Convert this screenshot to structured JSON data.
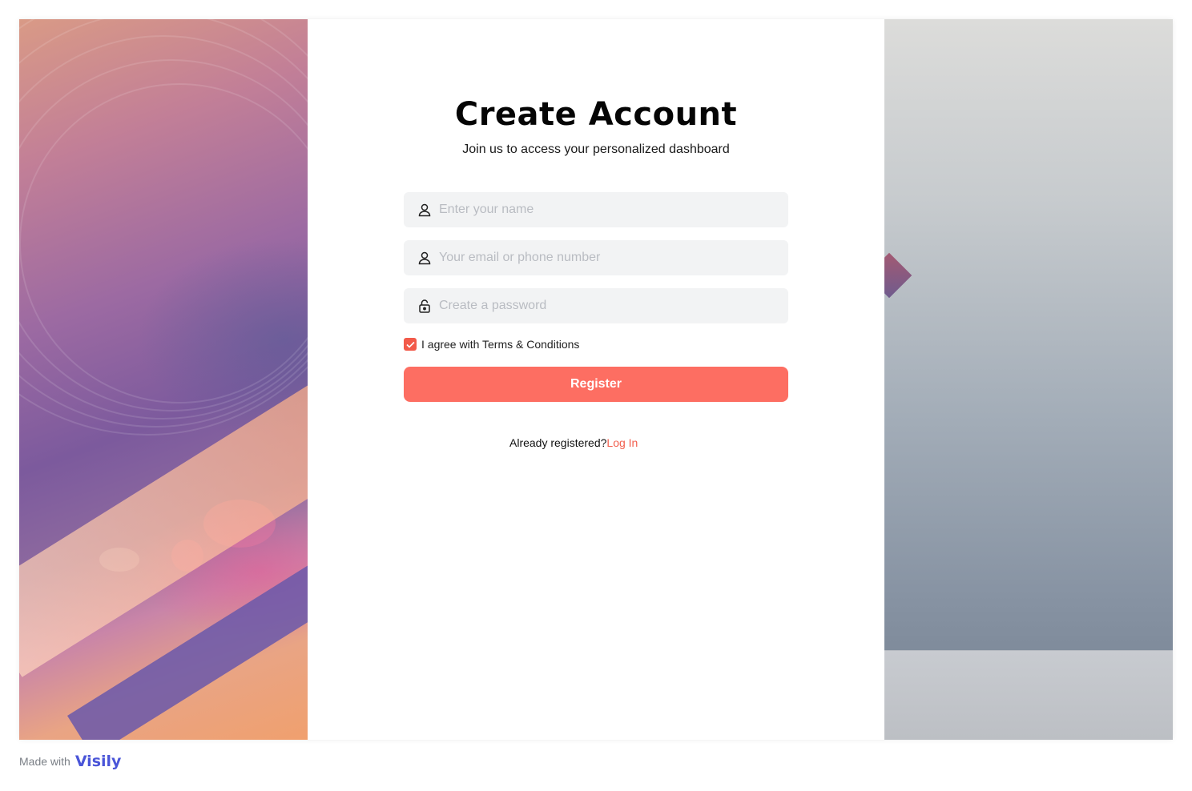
{
  "page": {
    "title": "Create Account",
    "subtitle": "Join us to access your personalized dashboard"
  },
  "form": {
    "name_placeholder": "Enter your name",
    "email_placeholder": "Your email or phone number",
    "password_placeholder": "Create a password",
    "agree_label": "I agree with Terms & Conditions",
    "agree_checked": true,
    "register_label": "Register",
    "already_text": "Already registered?",
    "login_link": "Log In"
  },
  "icons": {
    "name_field": "user-icon",
    "email_field": "user-icon",
    "password_field": "lock-icon",
    "checkbox": "check-icon"
  },
  "footer": {
    "made_with": "Made with",
    "brand": "Visily"
  },
  "colors": {
    "accent": "#fd6e62",
    "link": "#f2604f",
    "checkbox": "#f25a4a",
    "field_bg": "#f2f3f4",
    "brand": "#4a55d8"
  }
}
